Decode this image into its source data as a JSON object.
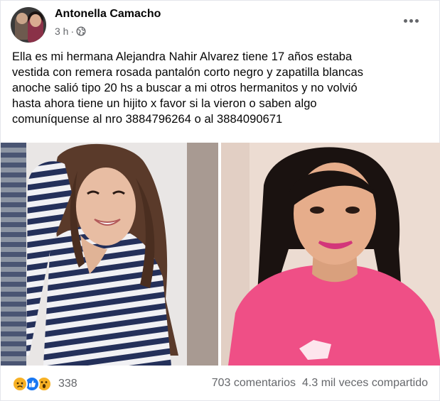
{
  "post": {
    "author": "Antonella Camacho",
    "time": "3 h",
    "privacy_icon": "globe-icon",
    "more_icon": "more-options-icon",
    "text": "Ella es mi hermana Alejandra Nahir Alvarez tiene 17 años  estaba\nvestida con remera rosada pantalón corto negro y zapatilla blancas\nanoche salió tipo 20 hs a buscar a mi otros hermanitos y no volvió\nhasta ahora tiene un hijito x favor si la vieron o saben algo\ncomuníquense al nro 3884796264 o al 3884090671"
  },
  "photos": [
    {
      "icon": "photo-girl-striped-shirt"
    },
    {
      "icon": "photo-girl-pink-shirt"
    }
  ],
  "footer": {
    "reactions": [
      "sad-reaction-icon",
      "like-reaction-icon",
      "wow-reaction-icon"
    ],
    "reaction_count": "338",
    "comments": "703 comentarios",
    "shares": "4.3 mil veces compartido"
  },
  "colors": {
    "text": "#050505",
    "secondary": "#65676b",
    "like_blue": "#1877f2",
    "reaction_yellow": "#f7b125"
  }
}
